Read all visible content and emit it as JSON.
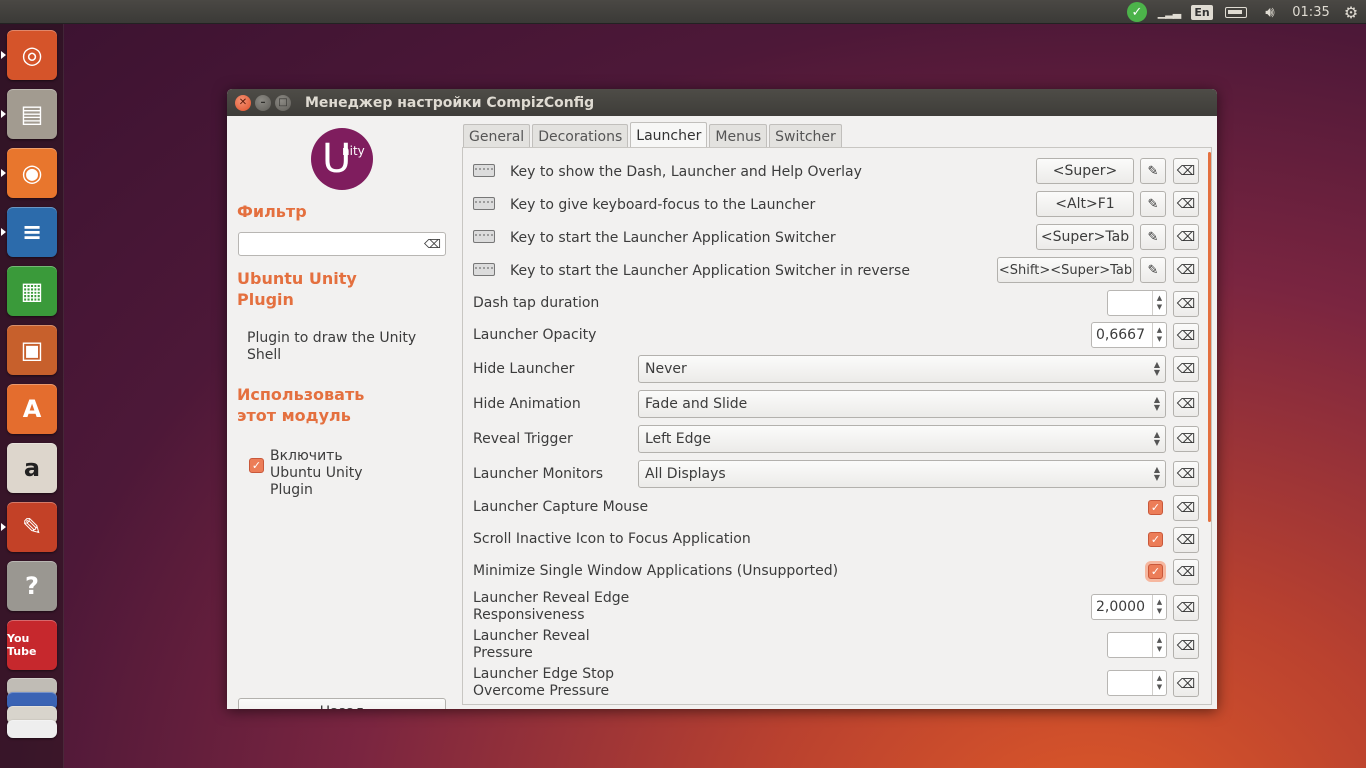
{
  "top_panel": {
    "language": "En",
    "time": "01:35"
  },
  "launcher": {
    "items": [
      {
        "name": "ubuntu-dash-icon",
        "glyph": "◎",
        "color": "#d5542a"
      },
      {
        "name": "files-icon",
        "glyph": "▤",
        "color": "#a29b90"
      },
      {
        "name": "firefox-icon",
        "glyph": "◉",
        "color": "#e8762d"
      },
      {
        "name": "libreoffice-writer-icon",
        "glyph": "≡",
        "color": "#2c6bab"
      },
      {
        "name": "libreoffice-calc-icon",
        "glyph": "▦",
        "color": "#3a9a3a"
      },
      {
        "name": "libreoffice-impress-icon",
        "glyph": "▣",
        "color": "#c7602c"
      },
      {
        "name": "software-center-icon",
        "glyph": "A",
        "color": "#e46d2e"
      },
      {
        "name": "amazon-icon",
        "glyph": "a",
        "color": "#ddd6cc"
      },
      {
        "name": "system-settings-icon",
        "glyph": "✎",
        "color": "#c34127"
      },
      {
        "name": "help-icon",
        "glyph": "?",
        "color": "#9a9791"
      },
      {
        "name": "youtube-icon",
        "glyph": "You Tube",
        "color": "#c6282d"
      }
    ]
  },
  "window": {
    "title": "Менеджер настройки CompizConfig"
  },
  "sidebar": {
    "logo_main": "U",
    "logo_suffix": "nity",
    "filter_heading": "Фильтр",
    "filter_value": "",
    "plugin_heading_line1": "Ubuntu Unity",
    "plugin_heading_line2": "Plugin",
    "plugin_description": "Plugin to draw the Unity Shell",
    "use_heading_line1": "Использовать",
    "use_heading_line2": "этот модуль",
    "enable_label": "Включить Ubuntu Unity Plugin",
    "enable_checked": true,
    "back_button": "Назад"
  },
  "tabs": [
    {
      "label": "General",
      "active": false
    },
    {
      "label": "Decorations",
      "active": false
    },
    {
      "label": "Launcher",
      "active": true
    },
    {
      "label": "Menus",
      "active": false
    },
    {
      "label": "Switcher",
      "active": false
    }
  ],
  "settings": {
    "key_dash": {
      "label": "Key to show the Dash, Launcher and Help Overlay",
      "value": "<Super>"
    },
    "key_focus": {
      "label": "Key to give keyboard-focus to the Launcher",
      "value": "<Alt>F1"
    },
    "key_switcher": {
      "label": "Key to start the Launcher Application Switcher",
      "value": "<Super>Tab"
    },
    "key_switcher_rev": {
      "label": "Key to start the Launcher Application Switcher in reverse",
      "value": "<Shift><Super>Tab"
    },
    "dash_tap": {
      "label": "Dash tap duration",
      "value": ""
    },
    "opacity": {
      "label": "Launcher Opacity",
      "value": "0,6667"
    },
    "hide_launcher": {
      "label": "Hide Launcher",
      "value": "Never"
    },
    "hide_animation": {
      "label": "Hide Animation",
      "value": "Fade and Slide"
    },
    "reveal_trigger": {
      "label": "Reveal Trigger",
      "value": "Left Edge"
    },
    "monitors": {
      "label": "Launcher Monitors",
      "value": "All Displays"
    },
    "capture_mouse": {
      "label": "Launcher Capture Mouse",
      "checked": true
    },
    "scroll_inactive": {
      "label": "Scroll Inactive Icon to Focus Application",
      "checked": true
    },
    "minimize_single": {
      "label": "Minimize Single Window Applications (Unsupported)",
      "checked": true
    },
    "reveal_edge": {
      "label_line1": "Launcher Reveal Edge",
      "label_line2": "Responsiveness",
      "value": "2,0000"
    },
    "reveal_pressure": {
      "label_line1": "Launcher Reveal",
      "label_line2": "Pressure",
      "value": ""
    },
    "edge_stop": {
      "label_line1": "Launcher Edge Stop",
      "label_line2": "Overcome Pressure",
      "value": ""
    }
  }
}
